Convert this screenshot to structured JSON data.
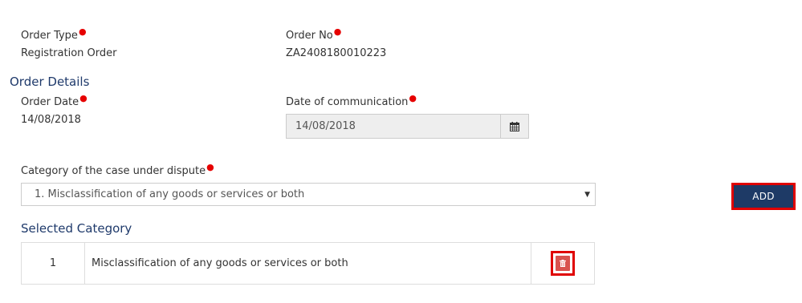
{
  "order_type": {
    "label": "Order Type",
    "value": "Registration Order"
  },
  "order_no": {
    "label": "Order No",
    "value": "ZA2408180010223"
  },
  "order_details": {
    "title": "Order Details",
    "order_date": {
      "label": "Order Date",
      "value": "14/08/2018"
    },
    "date_of_communication": {
      "label": "Date of communication",
      "value": "14/08/2018",
      "icon": "calendar-icon"
    }
  },
  "category": {
    "label": "Category of the case under dispute",
    "selected": "1. Misclassification of any goods or services or both",
    "add_label": "ADD"
  },
  "selected_category": {
    "title": "Selected Category",
    "rows": [
      {
        "num": "1",
        "text": "Misclassification of any goods or services or both",
        "action_icon": "trash-icon"
      }
    ]
  },
  "colors": {
    "accent": "#1e3a66",
    "required": "#e60000",
    "highlight": "#e00000",
    "delete": "#d9534f"
  }
}
